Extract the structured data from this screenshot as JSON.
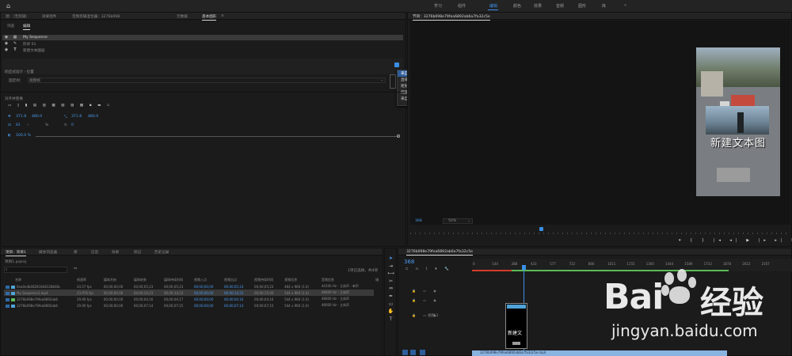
{
  "workspaces": [
    "学习",
    "组件",
    "编辑",
    "颜色",
    "效果",
    "音频",
    "图形",
    "库"
  ],
  "active_workspace": "编辑",
  "left_panel": {
    "tabs": [
      "源：（无剪辑）",
      "效果控件",
      "音频剪辑混合器：3276b098",
      "元数据",
      "基本图形"
    ],
    "subtabs": [
      "浏览",
      "编辑"
    ],
    "layers": [
      "My Sequence",
      "形状 01",
      "新建文本图层"
    ],
    "responsive_title": "响应式设计 - 位置",
    "pin_label": "固定到：",
    "pin_value": "视频帧",
    "align_title": "对齐并变换",
    "pos_x": "371.8",
    "pos_y": "480.0",
    "anchor_x": "371.8",
    "anchor_y": "480.0",
    "scale": "81",
    "opacity_unit": "%",
    "rotation": "0",
    "opacity_value": "100.0 %",
    "context_menu": [
      "来自图层",
      "直排文本",
      "矩形",
      "椭圆",
      "来自文件..."
    ]
  },
  "program_monitor": {
    "title": "节目：3276b098e79fea6892ab6a7fa32c5e",
    "timecode": "368",
    "zoom": "50%",
    "overlay_text": "新建文本图"
  },
  "project_panel": {
    "tabs": [
      "项目：项目1",
      "媒体浏览器",
      "库",
      "信息",
      "效果",
      "标记",
      "历史记录"
    ],
    "filename": "项目1.prproj",
    "selection": "1项已选择，共4项",
    "columns": [
      "名称",
      "帧速率",
      "媒体开始",
      "媒体结束",
      "媒体持续时间",
      "视频入点",
      "视频出点",
      "视频持续时间",
      "视频信息",
      "音频信息",
      "磁"
    ],
    "rows": [
      {
        "name": "0ea0e4b08281848128b66c",
        "fps": "24.57 fps",
        "start": "00;00;00;00",
        "end": "00;00;05;23",
        "dur": "00;00;05;23",
        "in": "00;00;00;00",
        "out": "00;00;05;23",
        "vdur": "00;00;05;23",
        "vinfo": "464 x 960 (1.0)",
        "ainfo": "44100 Hz - 立体声 - 单声",
        "color": "#4fa3d8"
      },
      {
        "name": "My Sequence1.mp4",
        "fps": "23.976 fps",
        "start": "00;00;00;00",
        "end": "00;00;14;23",
        "dur": "00;00;14;23",
        "in": "00;00;00;00",
        "out": "00;00;14;23",
        "vdur": "00;00;15;00",
        "vinfo": "544 x 960 (1.0)",
        "ainfo": "48000 Hz - 立体声",
        "color": "#4fa3d8"
      },
      {
        "name": "3276b098e79fea6892ab6",
        "fps": "29.90 fps",
        "start": "00;00;00;00",
        "end": "00;00;04;16",
        "dur": "00;00;04;17",
        "in": "00;00;00;00",
        "out": "00;00;04;16",
        "vdur": "00;00;04;16",
        "vinfo": "544 x 960 (1.0)",
        "ainfo": "48000 Hz - 立体声",
        "color": "#5bbb55"
      },
      {
        "name": "3276b098e79fea6892ab6",
        "fps": "29.90 fps",
        "start": "00;00;00;00",
        "end": "00;00;07;14",
        "dur": "00;00;07;15",
        "in": "00;00;00;00",
        "out": "00;00;07;14",
        "vdur": "00;00;07;15",
        "vinfo": "544 x 960 (1.0)",
        "ainfo": "48000 Hz - 立体声",
        "color": "#4fa3d8"
      }
    ]
  },
  "timeline": {
    "title": "3276b098e79fea6892ab6a7fa32c5e",
    "timecode": "368",
    "ruler": [
      "0",
      "144",
      "288",
      "433",
      "577",
      "722",
      "866",
      "1011",
      "1155",
      "1300",
      "1444",
      "1589",
      "1733",
      "1878",
      "2022",
      "2167"
    ],
    "track_label": "视频 1",
    "clip_name": "3276b098e79fea6892ab6a7fa32c5e.mp4",
    "clip_thumb_text": "新建文"
  },
  "watermark": {
    "logo_left": "Bai",
    "logo_right": "经验",
    "url": "jingyan.baidu.com"
  }
}
